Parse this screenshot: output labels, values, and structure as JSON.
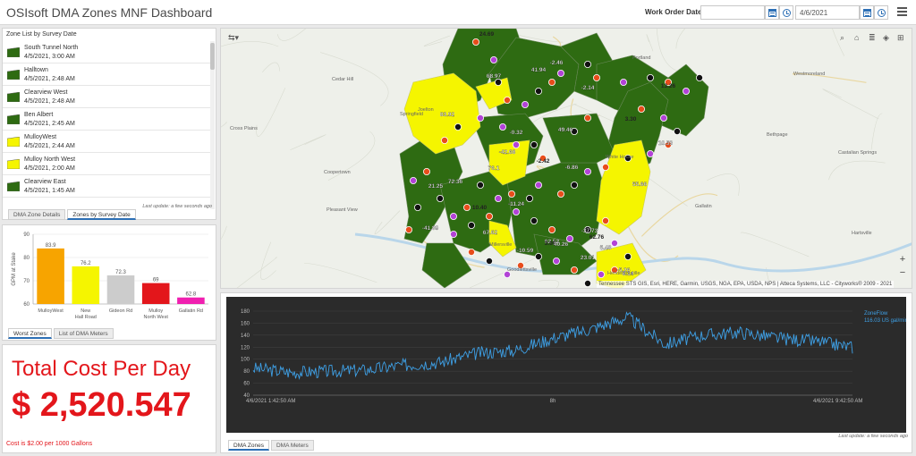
{
  "header": {
    "title": "OSIsoft DMA Zones MNF Dashboard",
    "work_order_label": "Work Order Dates",
    "start_date": "",
    "end_date": "4/6/2021",
    "menu_icon": "hamburger-icon",
    "calendar_icon": "calendar-icon",
    "clock_icon": "clock-icon"
  },
  "zone_list": {
    "title": "Zone List by Survey Date",
    "items": [
      {
        "name": "South Tunnel North",
        "date": "4/5/2021, 3:00 AM",
        "color": "#2e6b12"
      },
      {
        "name": "Halltown",
        "date": "4/5/2021, 2:48 AM",
        "color": "#2e6b12"
      },
      {
        "name": "Clearview West",
        "date": "4/5/2021, 2:48 AM",
        "color": "#2e6b12"
      },
      {
        "name": "Ben Albert",
        "date": "4/5/2021, 2:45 AM",
        "color": "#2e6b12"
      },
      {
        "name": "MulloyWest",
        "date": "4/5/2021, 2:44 AM",
        "color": "#f5f500"
      },
      {
        "name": "Mulloy North West",
        "date": "4/5/2021, 2:00 AM",
        "color": "#f5f500"
      },
      {
        "name": "Clearview East",
        "date": "4/5/2021, 1:45 AM",
        "color": "#2e6b12"
      }
    ],
    "last_update": "Last update: a few seconds ago",
    "tabs": [
      "DMA Zone Details",
      "Zones by Survey Date"
    ],
    "active_tab": 1
  },
  "bar_panel": {
    "tabs": [
      "Worst Zones",
      "List of DMA Meters"
    ],
    "active_tab": 0
  },
  "chart_data": [
    {
      "type": "bar",
      "categories": [
        "MulloyWest",
        "New Hall Road",
        "Gideon Rd",
        "Mulloy North West",
        "Gallatin Rd"
      ],
      "values": [
        83.9,
        76.2,
        72.3,
        69,
        62.8
      ],
      "data_labels": [
        "83.9",
        "76.2",
        "72.3",
        "69",
        "62.8"
      ],
      "colors": [
        "#f7a400",
        "#f5f500",
        "#cccccc",
        "#e3161b",
        "#f020b0"
      ],
      "ylabel": "GPM at Stake",
      "ylim": [
        60,
        90
      ],
      "yticks": [
        60,
        70,
        80,
        90
      ],
      "grid": true
    },
    {
      "type": "line",
      "series": [
        {
          "name": "ZoneFlow",
          "color": "#3ea0e6"
        }
      ],
      "legend_value": "116.03 US gal/min",
      "ylim": [
        40,
        180
      ],
      "yticks": [
        40,
        60,
        80,
        100,
        120,
        140,
        160,
        180
      ],
      "x_labels": [
        "4/6/2021 1:42:50 AM",
        "8h",
        "4/6/2021 9:42:50 AM"
      ],
      "keypoints_x_hours": [
        0,
        0.5,
        1,
        1.5,
        2,
        2.5,
        3,
        3.5,
        4,
        4.5,
        5,
        5.5,
        6,
        6.5,
        7,
        7.5,
        8
      ],
      "keypoints_y": [
        85,
        78,
        80,
        82,
        90,
        95,
        110,
        115,
        135,
        150,
        170,
        125,
        140,
        145,
        135,
        130,
        120
      ]
    }
  ],
  "cost": {
    "title": "Total Cost Per Day",
    "value": "$ 2,520.547",
    "note": "Cost is $2.00 per 1000 Gallons"
  },
  "map": {
    "attribution": "Tennessee STS GIS, Esri, HERE, Garmin, USGS, NGA, EPA, USDA, NPS | Atteca Systems, LLC - Cityworks® 2009 - 2021",
    "zoom_in": "+",
    "zoom_out": "−",
    "zone_labels": [
      "24.69",
      "68.97",
      "41.94",
      "-2.46",
      "-2.14",
      "13.26",
      "83.92",
      "-42.68",
      "-0.32",
      "49.46",
      "3.30",
      "10.53",
      "76.1",
      "55.66",
      "-6.86",
      "-2.42",
      "-11.24",
      "72.36",
      "21.25",
      "-41.89",
      "10.40",
      "62.52",
      "-10.59",
      "67.62",
      "-37.73",
      "3.00",
      "40.26",
      "23.01",
      "5.48",
      "-5.26",
      "62.76",
      "8.14"
    ],
    "place_labels": [
      "Cedar Hill",
      "Portland",
      "Westmoreland",
      "Springfield",
      "Cross Plains",
      "White House",
      "Bethpage",
      "Coopertown",
      "Pleasant View",
      "Gallatin",
      "Hartsville",
      "Goodlettsville",
      "Hendersonville",
      "Joelton",
      "Millersville",
      "Castalian Springs"
    ],
    "toolbar_icons": [
      "search-icon",
      "home-icon",
      "list-icon",
      "layers-icon",
      "grid-icon"
    ]
  },
  "timeseries_panel": {
    "last_update": "Last update: a few seconds ago",
    "tabs": [
      "DMA Zones",
      "DMA Meters"
    ],
    "active_tab": 0
  }
}
